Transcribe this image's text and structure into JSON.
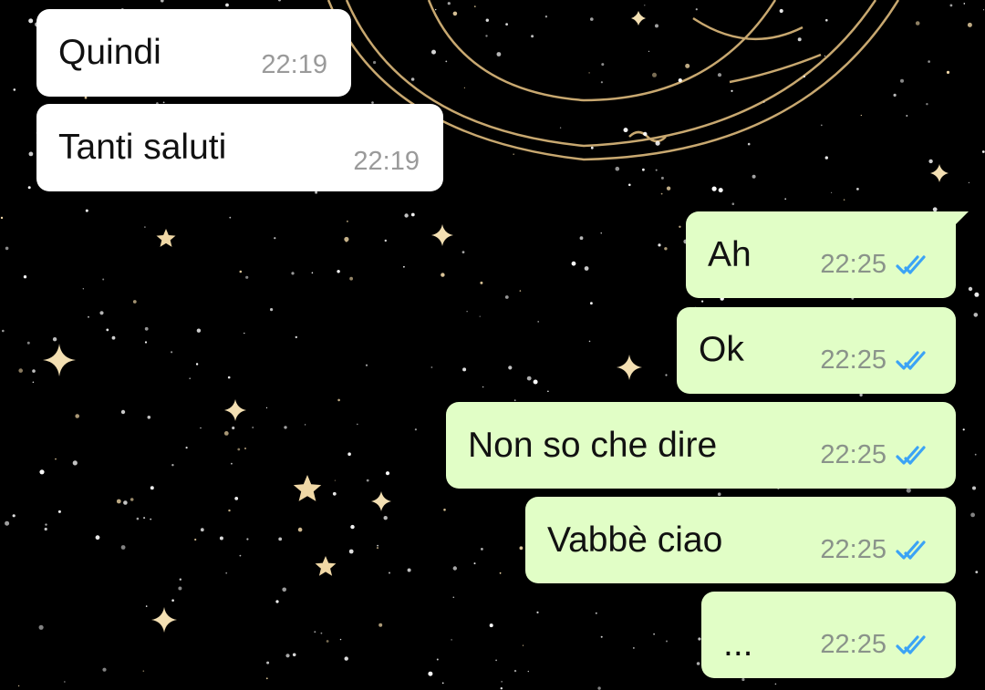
{
  "chat": {
    "incoming": [
      {
        "text": "Quindi",
        "time": "22:19"
      },
      {
        "text": "Tanti saluti",
        "time": "22:19"
      }
    ],
    "outgoing": [
      {
        "text": "Ah",
        "time": "22:25",
        "status": "read"
      },
      {
        "text": "Ok",
        "time": "22:25",
        "status": "read"
      },
      {
        "text": "Non so che dire",
        "time": "22:25",
        "status": "read"
      },
      {
        "text": "Vabbè ciao",
        "time": "22:25",
        "status": "read"
      },
      {
        "text": "...",
        "time": "22:25",
        "status": "read"
      }
    ]
  },
  "colors": {
    "incoming_bubble": "#ffffff",
    "outgoing_bubble": "#e1fec6",
    "read_ticks": "#3ba3f5",
    "wallpaper": "#000000",
    "wallpaper_lines": "#c8a870"
  },
  "icons": {
    "read_status": "double-check-icon"
  }
}
